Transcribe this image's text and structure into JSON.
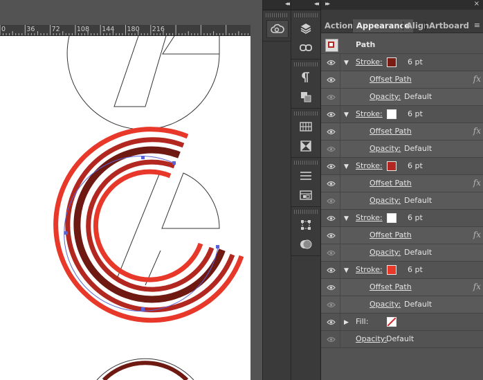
{
  "ruler": {
    "labels": [
      "0",
      "36",
      "72",
      "108",
      "144",
      "180",
      "216"
    ]
  },
  "panel": {
    "tabs": [
      "Actions",
      "Appearance",
      "Align",
      "Artboard"
    ],
    "active_tab": "Appearance",
    "header": {
      "label": "Path"
    },
    "items": [
      {
        "kind": "stroke",
        "label": "Stroke:",
        "color": "#7a1c14",
        "weight": "6 pt"
      },
      {
        "kind": "effect",
        "label": "Offset Path",
        "fx": "fx"
      },
      {
        "kind": "opacity",
        "label": "Opacity:",
        "value": "Default"
      },
      {
        "kind": "stroke",
        "label": "Stroke:",
        "color": "#ffffff",
        "weight": "6 pt"
      },
      {
        "kind": "effect",
        "label": "Offset Path",
        "fx": "fx"
      },
      {
        "kind": "opacity",
        "label": "Opacity:",
        "value": "Default"
      },
      {
        "kind": "stroke",
        "label": "Stroke:",
        "color": "#b22820",
        "weight": "6 pt"
      },
      {
        "kind": "effect",
        "label": "Offset Path",
        "fx": "fx"
      },
      {
        "kind": "opacity",
        "label": "Opacity:",
        "value": "Default"
      },
      {
        "kind": "stroke",
        "label": "Stroke:",
        "color": "#ffffff",
        "weight": "6 pt"
      },
      {
        "kind": "effect",
        "label": "Offset Path",
        "fx": "fx"
      },
      {
        "kind": "opacity",
        "label": "Opacity:",
        "value": "Default"
      },
      {
        "kind": "stroke",
        "label": "Stroke:",
        "color": "#e8382a",
        "weight": "6 pt"
      },
      {
        "kind": "effect",
        "label": "Offset Path",
        "fx": "fx"
      },
      {
        "kind": "opacity",
        "label": "Opacity:",
        "value": "Default"
      },
      {
        "kind": "fill",
        "label": "Fill:",
        "color": "none"
      },
      {
        "kind": "opacity-path",
        "label": "Opacity:",
        "value": "Default"
      }
    ]
  },
  "icons": {
    "strip1": [
      "creative-cloud-icon"
    ],
    "strip2": [
      "layers-icon",
      "links-icon",
      "paragraph-icon",
      "pathfinder-icon",
      "swatches-grid-icon",
      "transparency-icon",
      "align-lines-icon",
      "artboards-icon",
      "transform-icon",
      "color-guide-icon"
    ]
  },
  "colors": {
    "accent_link": "#f2a33a",
    "red_light": "#e8382a",
    "red_mid": "#b22820",
    "red_dark": "#6e1a12",
    "selection": "#5a63d6"
  }
}
